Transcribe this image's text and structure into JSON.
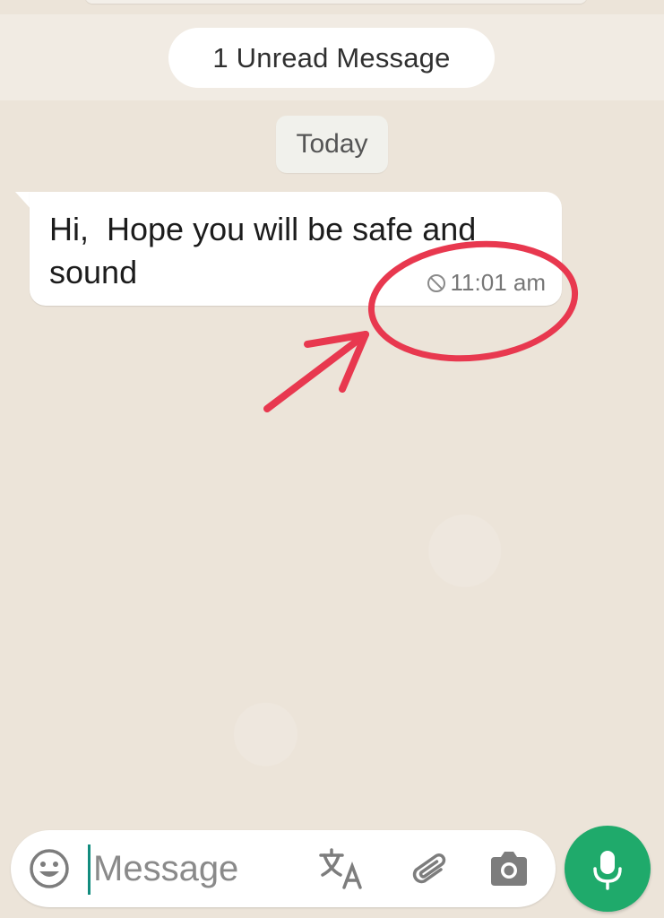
{
  "chat": {
    "unread_banner": "1 Unread Message",
    "date_separator": "Today",
    "messages": [
      {
        "text": "Hi,  Hope you will be safe and sound",
        "time": "11:01 am",
        "status_icon": "blocked-icon",
        "direction": "incoming"
      }
    ]
  },
  "annotation": {
    "color": "#e8384f",
    "shapes": [
      "circle-highlight",
      "arrow"
    ]
  },
  "composer": {
    "placeholder": "Message",
    "value": "",
    "icons": [
      "emoji-icon",
      "translate-icon",
      "paperclip-icon",
      "camera-icon"
    ],
    "send_icon": "microphone-icon"
  },
  "colors": {
    "accent": "#1faa6b",
    "chat_background": "#ece4d9",
    "bubble": "#ffffff"
  }
}
